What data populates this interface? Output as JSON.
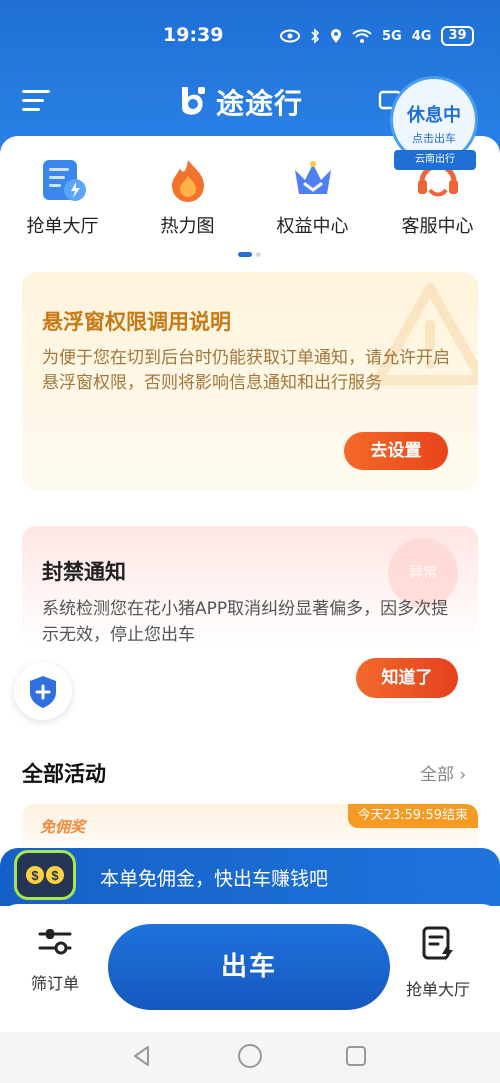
{
  "status_bar": {
    "time": "19:39",
    "signal_1": "5G",
    "signal_2": "4G",
    "battery": "39"
  },
  "header": {
    "app_title": "途途行",
    "rest_badge": {
      "title": "休息中",
      "subtitle": "点击出车",
      "tag": "云南出行"
    }
  },
  "quick_actions": [
    {
      "label": "抢单大厅",
      "icon": "order-document-icon"
    },
    {
      "label": "热力图",
      "icon": "flame-icon"
    },
    {
      "label": "权益中心",
      "icon": "crown-icon"
    },
    {
      "label": "客服中心",
      "icon": "customer-service-icon"
    }
  ],
  "float_permission_card": {
    "title": "悬浮窗权限调用说明",
    "description": "为便于您在切到后台时仍能获取订单通知，请允许开启悬浮窗权限，否则将影响信息通知和出行服务",
    "button": "去设置"
  },
  "ban_card": {
    "title": "封禁通知",
    "description": "系统检测您在花小猪APP取消纠纷显著偏多，因多次提示无效，停止您出车",
    "button": "知道了",
    "deco_text": "异常"
  },
  "activities": {
    "title": "全部活动",
    "more": "全部",
    "card_tag": "免佣奖",
    "deadline": "今天23:59:59结束"
  },
  "promo": {
    "text": "本单免佣金，快出车赚钱吧"
  },
  "bottom_bar": {
    "filter_label": "筛订单",
    "go_label": "出车",
    "grab_label": "抢单大厅"
  },
  "colors": {
    "brand_blue": "#1f6fd6",
    "orange": "#e9441a",
    "warning_text": "#c77a17"
  }
}
